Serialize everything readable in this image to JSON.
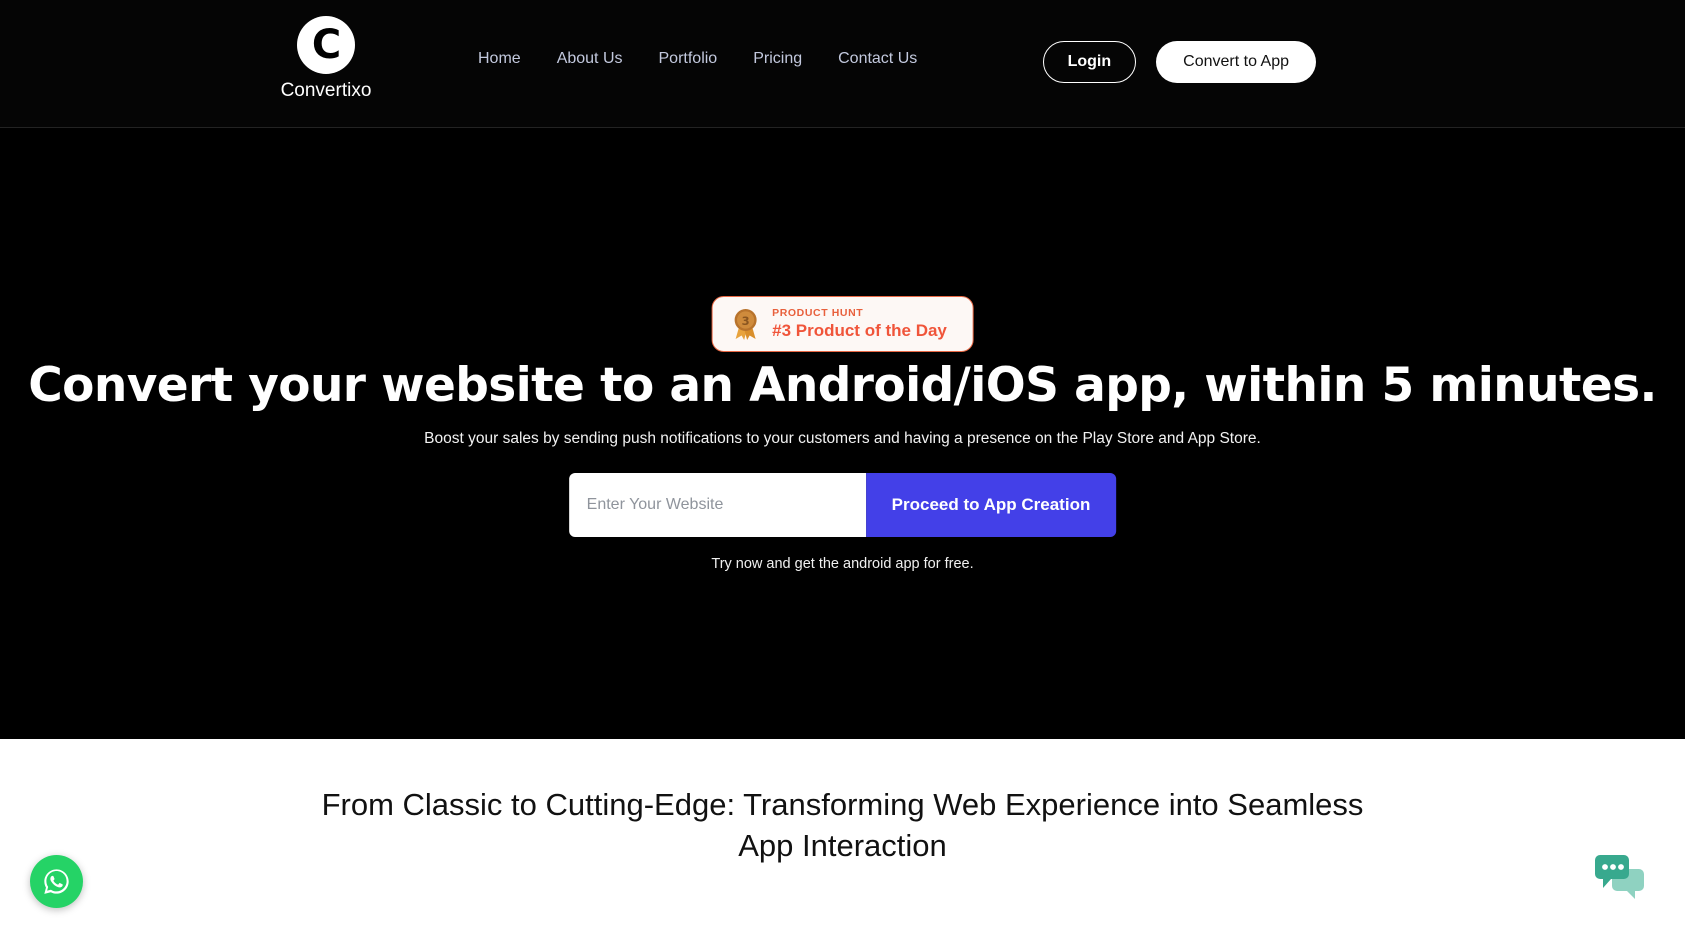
{
  "brand": {
    "mark_letter": "C",
    "name": "Convertixo"
  },
  "nav": {
    "items": [
      {
        "label": "Home"
      },
      {
        "label": "About Us"
      },
      {
        "label": "Portfolio"
      },
      {
        "label": "Pricing"
      },
      {
        "label": "Contact Us"
      }
    ]
  },
  "header_actions": {
    "login_label": "Login",
    "convert_label": "Convert to App"
  },
  "hero": {
    "badge": {
      "kicker": "PRODUCT HUNT",
      "title": "#3 Product of the Day",
      "medal_rank": "3",
      "medal_icon": "medal-icon",
      "border_color": "#e86844",
      "text_color": "#f0553a",
      "background": "#fdf8f5"
    },
    "headline": "Convert your website to an Android/iOS app, within 5 minutes.",
    "subhead": "Boost your sales by sending push notifications to your customers and having a presence on the Play Store and App Store.",
    "input_placeholder": "Enter Your Website",
    "input_value": "",
    "cta_label": "Proceed to App Creation",
    "cta_color": "#4340e8",
    "note": "Try now and get the android app for free."
  },
  "section": {
    "heading": "From Classic to Cutting-Edge: Transforming Web Experience into Seamless App Interaction"
  },
  "widgets": {
    "whatsapp": {
      "icon": "whatsapp-icon",
      "color": "#25d366"
    },
    "chat": {
      "icon": "chat-bubbles-icon",
      "color": "#3aae92"
    }
  }
}
